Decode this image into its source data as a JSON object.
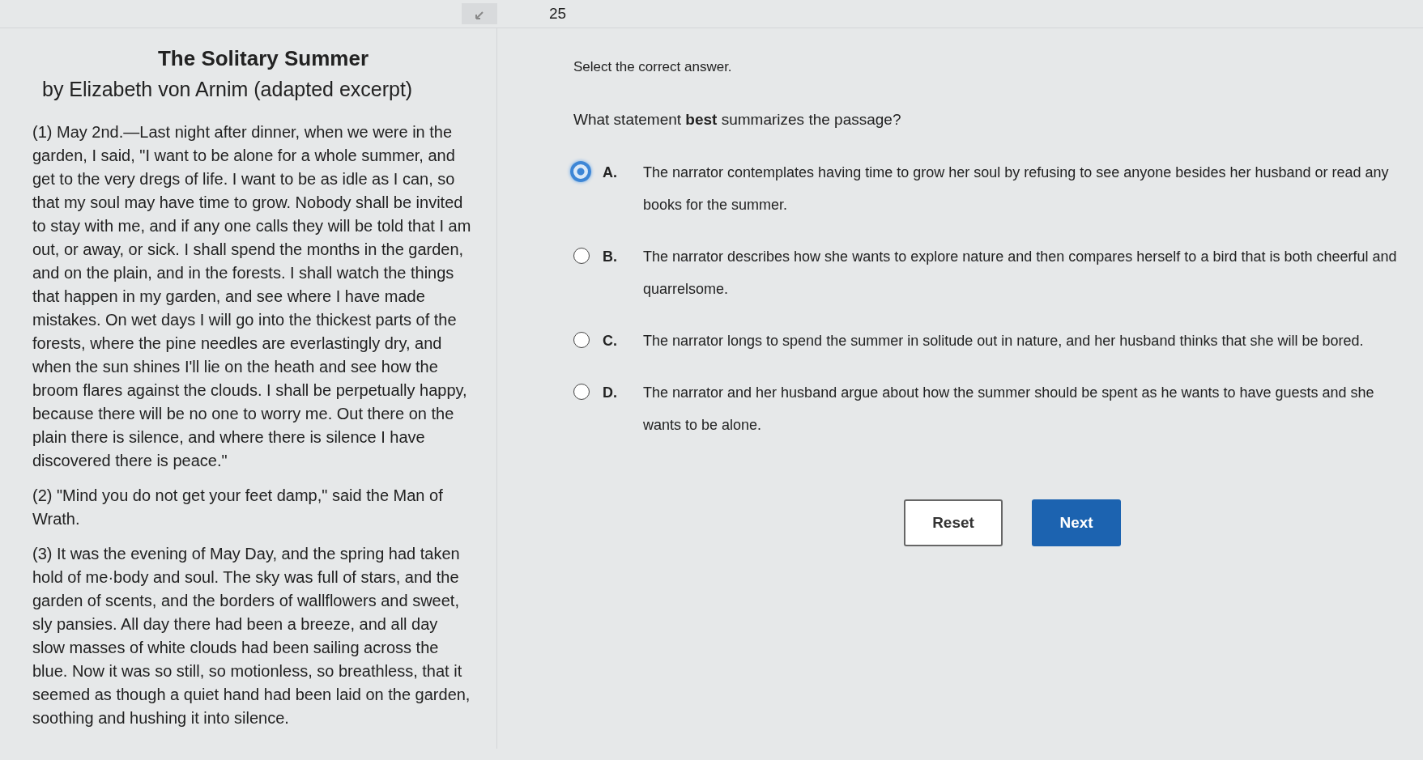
{
  "header": {
    "question_number": "25"
  },
  "passage": {
    "title": "The Solitary Summer",
    "subtitle": "by Elizabeth von Arnim (adapted excerpt)",
    "paragraphs": [
      "(1) May 2nd.—Last night after dinner, when we were in the garden, I said, \"I want to be alone for a whole summer, and get to the very dregs of life. I want to be as idle as I can, so that my soul may have time to grow. Nobody shall be invited to stay with me, and if any one calls they will be told that I am out, or away, or sick. I shall spend the months in the garden, and on the plain, and in the forests. I shall watch the things that happen in my garden, and see where I have made mistakes. On wet days I will go into the thickest parts of the forests, where the pine needles are everlastingly dry, and when the sun shines I'll lie on the heath and see how the broom flares against the clouds. I shall be perpetually happy, because there will be no one to worry me. Out there on the plain there is silence, and where there is silence I have discovered there is peace.\"",
      "(2) \"Mind you do not get your feet damp,\" said the Man of Wrath.",
      "(3) It was the evening of May Day, and the spring had taken hold of me·body and soul. The sky was full of stars, and the garden of scents, and the borders of wallflowers and sweet, sly pansies. All day there had been a breeze, and all day slow masses of white clouds had been sailing across the blue. Now it was so still, so motionless, so breathless, that it seemed as though a quiet hand had been laid on the garden, soothing and hushing it into silence."
    ]
  },
  "question": {
    "instruction": "Select the correct answer.",
    "prompt": "What statement **best** summarizes the passage?",
    "options": [
      {
        "letter": "A.",
        "text": "The narrator contemplates having time to grow her soul by refusing to see anyone besides her husband or read any books for the summer.",
        "selected": true
      },
      {
        "letter": "B.",
        "text": "The narrator describes how she wants to explore nature and then compares herself to a bird that is both cheerful and quarrelsome.",
        "selected": false
      },
      {
        "letter": "C.",
        "text": "The narrator longs to spend the summer in solitude out in nature, and her husband thinks that she will be bored.",
        "selected": false
      },
      {
        "letter": "D.",
        "text": "The narrator and her husband argue about how the summer should be spent as he wants to have guests and she wants to be alone.",
        "selected": false
      }
    ]
  },
  "buttons": [
    {
      "label": "Reset",
      "kind": "secondary"
    },
    {
      "label": "Next",
      "kind": "primary"
    }
  ]
}
